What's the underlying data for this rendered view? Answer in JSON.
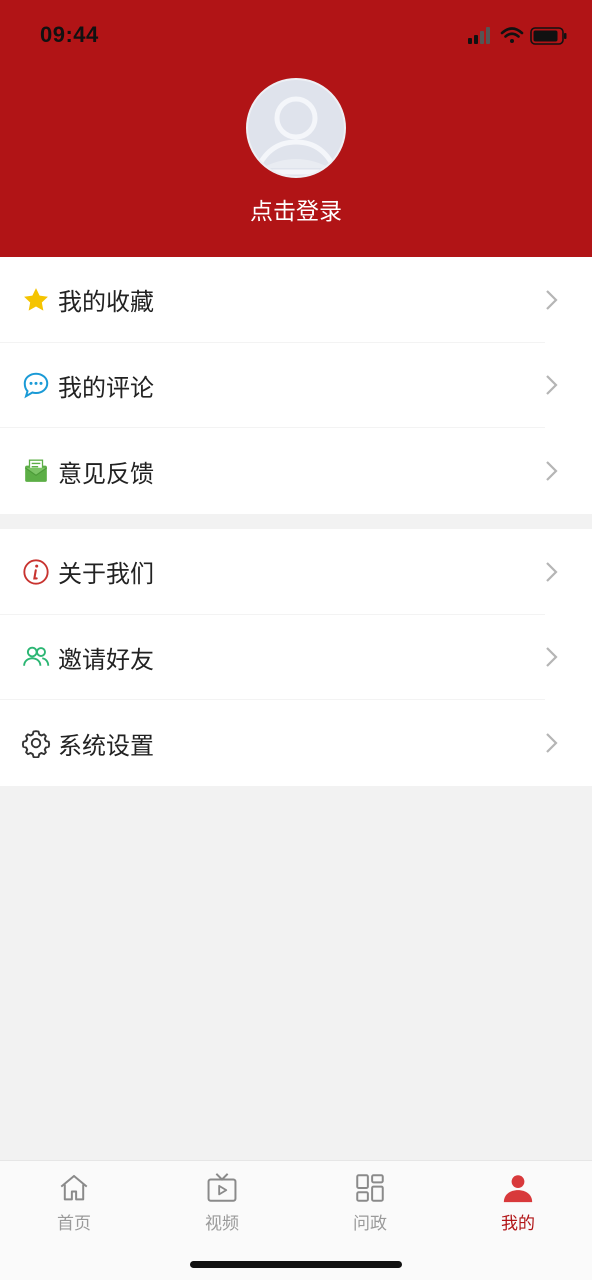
{
  "status_bar": {
    "time": "09:44"
  },
  "profile": {
    "login_label": "点击登录"
  },
  "menu": {
    "group1": [
      {
        "label": "我的收藏",
        "icon": "star-icon"
      },
      {
        "label": "我的评论",
        "icon": "comment-icon"
      },
      {
        "label": "意见反馈",
        "icon": "feedback-mail-icon"
      }
    ],
    "group2": [
      {
        "label": "关于我们",
        "icon": "info-icon"
      },
      {
        "label": "邀请好友",
        "icon": "friends-icon"
      },
      {
        "label": "系统设置",
        "icon": "gear-icon"
      }
    ]
  },
  "tabbar": {
    "tabs": [
      {
        "label": "首页",
        "icon": "home-icon"
      },
      {
        "label": "视频",
        "icon": "tv-icon"
      },
      {
        "label": "问政",
        "icon": "grid-icon"
      },
      {
        "label": "我的",
        "icon": "person-icon",
        "active": true
      }
    ]
  },
  "colors": {
    "brand": "#b11416",
    "inactive": "#9a9a9a"
  }
}
